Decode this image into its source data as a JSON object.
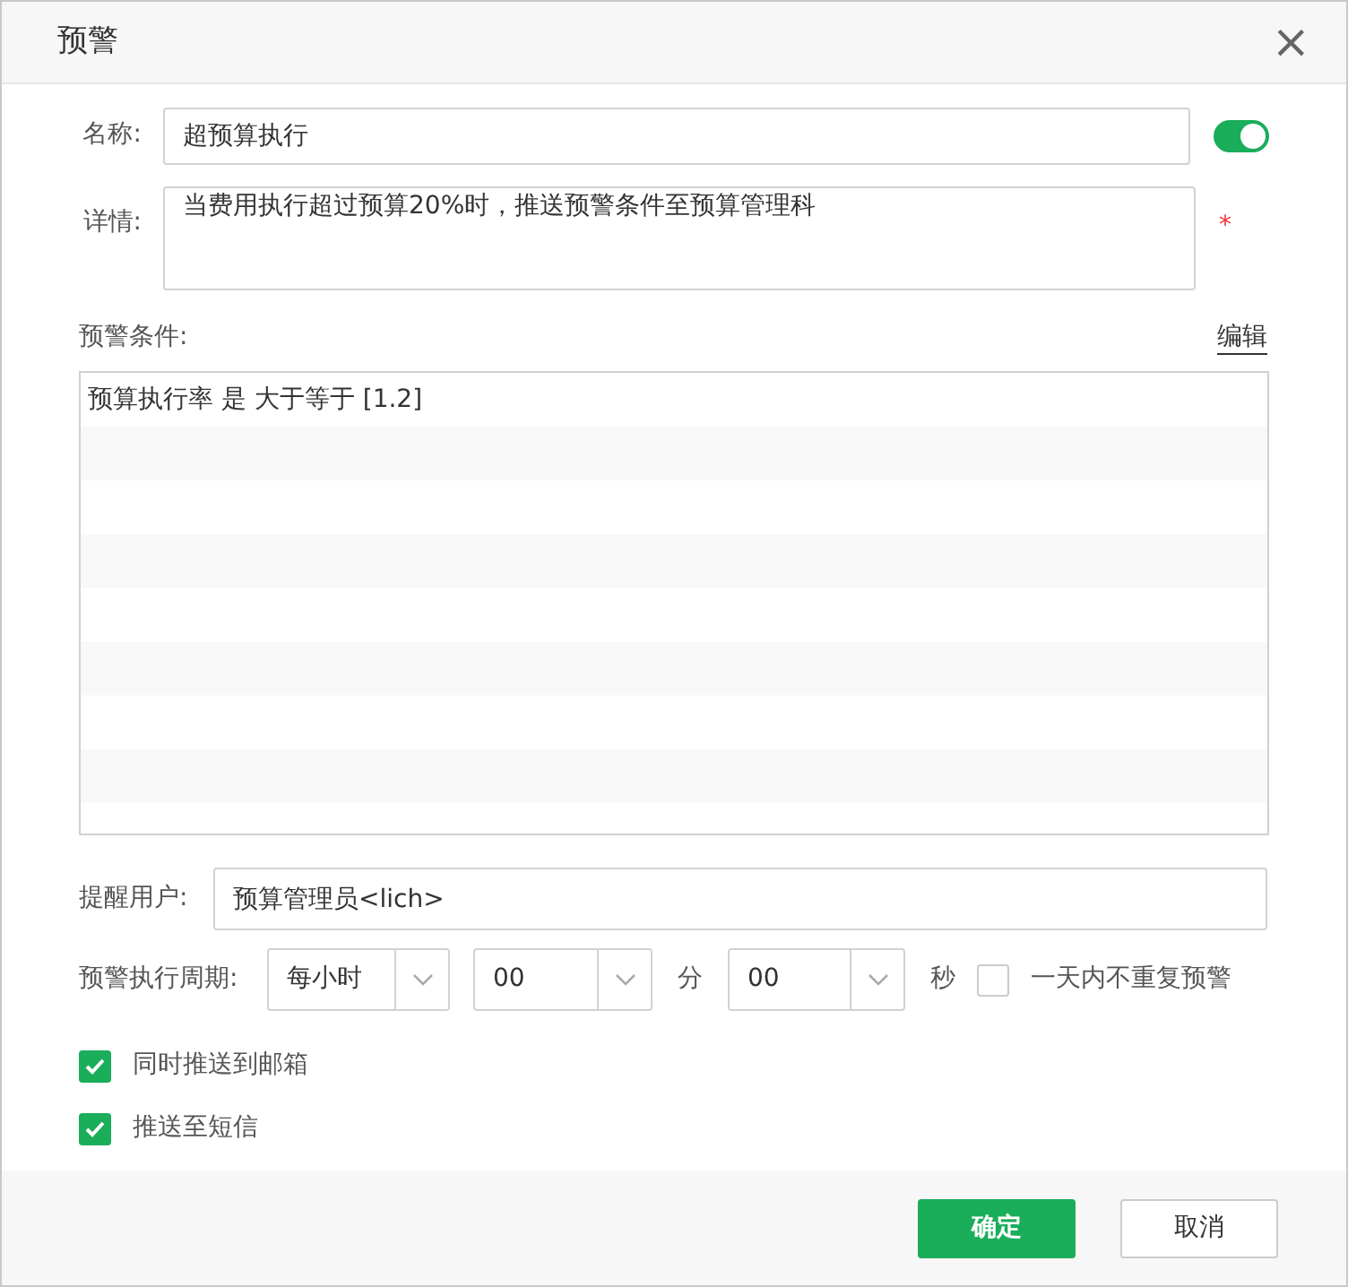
{
  "dialog": {
    "title": "预警",
    "close": "×"
  },
  "name_field": {
    "label": "名称:",
    "value": "超预算执行"
  },
  "enabled": true,
  "detail_field": {
    "label": "详情:",
    "value": "当费用执行超过预算20%时，推送预警条件至预算管理科",
    "required_mark": "*"
  },
  "conditions": {
    "label": "预警条件:",
    "edit_link": "编辑",
    "lines": [
      "预算执行率 是 大于等于 [1.2]"
    ]
  },
  "notify_user": {
    "label": "提醒用户:",
    "value": "预算管理员<lich>"
  },
  "period": {
    "label": "预警执行周期:",
    "frequency": "每小时",
    "minute": "00",
    "minute_unit": "分",
    "second": "00",
    "second_unit": "秒",
    "no_repeat": {
      "label": "一天内不重复预警",
      "checked": false
    }
  },
  "options": [
    {
      "label": "同时推送到邮箱",
      "checked": true
    },
    {
      "label": "推送至短信",
      "checked": true
    }
  ],
  "buttons": [
    {
      "label": "确定",
      "kind": "primary"
    },
    {
      "label": "取消",
      "kind": "secondary"
    }
  ]
}
